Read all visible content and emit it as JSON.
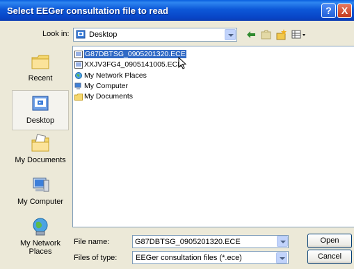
{
  "window": {
    "title": "Select EEGer consultation file to read",
    "help_label": "?",
    "close_label": "X"
  },
  "lookin": {
    "label": "Look in:",
    "value": "Desktop"
  },
  "places": [
    {
      "label": "Recent",
      "icon": "recent-folder-icon"
    },
    {
      "label": "Desktop",
      "icon": "desktop-icon",
      "selected": true
    },
    {
      "label": "My Documents",
      "icon": "my-documents-icon"
    },
    {
      "label": "My Computer",
      "icon": "my-computer-icon"
    },
    {
      "label": "My Network Places",
      "icon": "network-places-icon"
    }
  ],
  "files": [
    {
      "name": "G87DBTSG_0905201320.ECE",
      "icon": "ece-file-icon",
      "selected": true
    },
    {
      "name": "XXJV3FG4_0905141005.ECE",
      "icon": "ece-file-icon"
    },
    {
      "name": "My Network Places",
      "icon": "network-places-icon"
    },
    {
      "name": "My Computer",
      "icon": "my-computer-icon"
    },
    {
      "name": "My Documents",
      "icon": "my-documents-icon"
    }
  ],
  "filename": {
    "label": "File name:",
    "value": "G87DBTSG_0905201320.ECE"
  },
  "filetype": {
    "label": "Files of type:",
    "value": "EEGer consultation files (*.ece)"
  },
  "buttons": {
    "open": "Open",
    "cancel": "Cancel"
  },
  "colors": {
    "title_bar": "#0A5FDE",
    "selection": "#316AC5",
    "dialog_bg": "#ECE9D8"
  }
}
